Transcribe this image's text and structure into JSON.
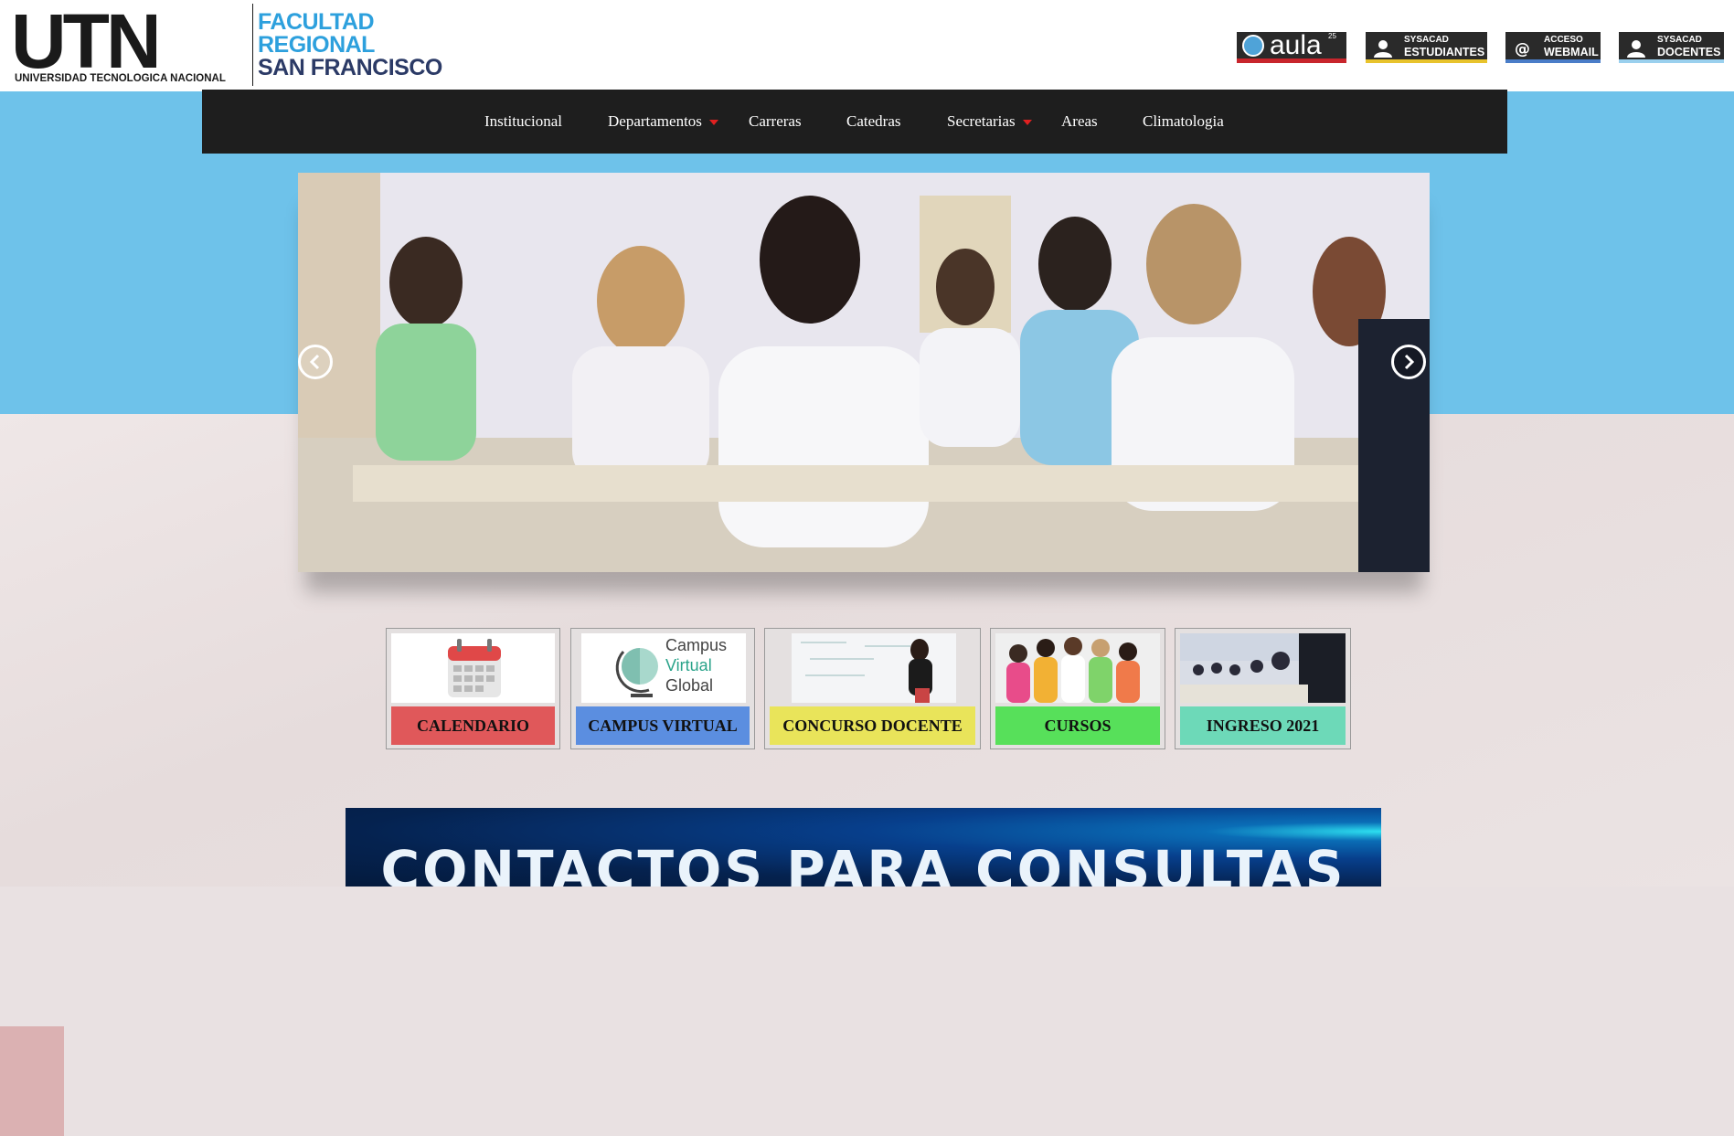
{
  "header": {
    "logo_main": "UTN",
    "logo_sub": "UNIVERSIDAD TECNOLOGICA NACIONAL",
    "faculty": {
      "line1": "FACULTAD",
      "line2": "REGIONAL",
      "line3": "SAN FRANCISCO"
    },
    "links": {
      "aula": {
        "text": "aula",
        "sup": "25"
      },
      "estudiantes": {
        "line1": "SYSACAD",
        "line2": "ESTUDIANTES",
        "accent": "#e8c32c"
      },
      "webmail": {
        "line1": "ACCESO",
        "line2": "WEBMAIL",
        "accent": "#4a7dc8"
      },
      "docentes": {
        "line1": "SYSACAD",
        "line2": "DOCENTES",
        "accent": "#9ad0ee"
      }
    }
  },
  "nav": {
    "items": [
      {
        "label": "Institucional",
        "dropdown": false
      },
      {
        "label": "Departamentos",
        "dropdown": true
      },
      {
        "label": "Carreras",
        "dropdown": false
      },
      {
        "label": "Catedras",
        "dropdown": false
      },
      {
        "label": "Secretarias",
        "dropdown": true
      },
      {
        "label": "Areas",
        "dropdown": false
      },
      {
        "label": "Climatologia",
        "dropdown": false
      }
    ]
  },
  "slider": {
    "icons": [
      "chevron-left-icon",
      "chevron-right-icon"
    ]
  },
  "tiles": [
    {
      "label": "CALENDARIO",
      "color": "#e0585a"
    },
    {
      "label": "CAMPUS VIRTUAL",
      "color": "#5b8ee0",
      "image_text": {
        "l1": "Campus",
        "l2": "Virtual",
        "l3": "Global"
      }
    },
    {
      "label": "CONCURSO DOCENTE",
      "color": "#e9e45a"
    },
    {
      "label": "CURSOS",
      "color": "#57e05a"
    },
    {
      "label": "INGRESO 2021",
      "color": "#6dd9b8"
    }
  ],
  "contact": {
    "title": "CONTACTOS PARA CONSULTAS"
  },
  "colors": {
    "nav_bg": "#1e1e1e",
    "band": "#6ec2ea",
    "caret": "#e02020"
  }
}
